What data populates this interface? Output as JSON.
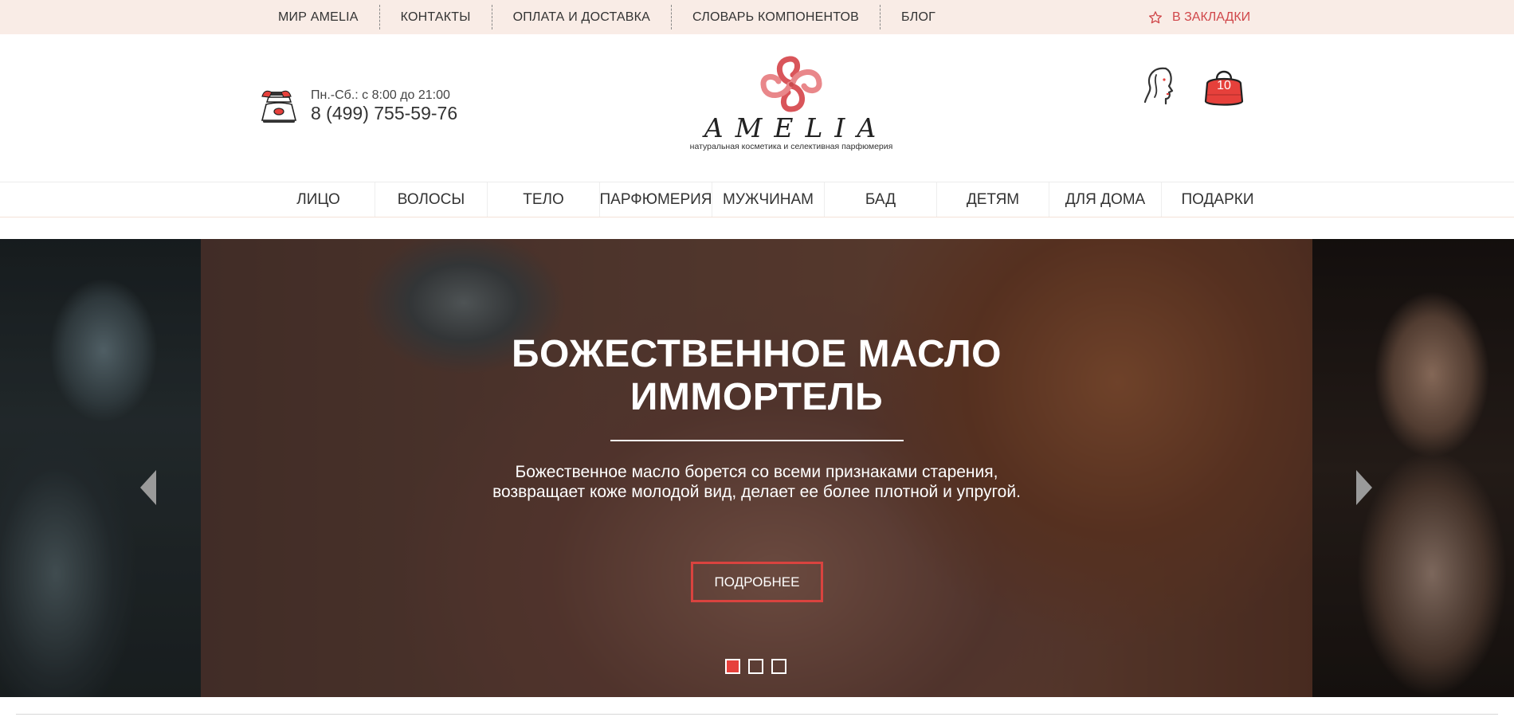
{
  "topbar": {
    "links": [
      "МИР AMELIA",
      "КОНТАКТЫ",
      "ОПЛАТА И ДОСТАВКА",
      "СЛОВАРЬ КОМПОНЕНТОВ",
      "БЛОГ"
    ],
    "bookmarks_label": "В ЗАКЛАДКИ"
  },
  "header": {
    "hours": "Пн.-Сб.: с 8:00 до 21:00",
    "phone": "8 (499) 755-59-76",
    "logo_name": "AMELIA",
    "logo_tagline": "натуральная косметика и селективная парфюмерия",
    "cart_count": "10"
  },
  "mainnav": {
    "items": [
      "ЛИЦО",
      "ВОЛОСЫ",
      "ТЕЛО",
      "ПАРФЮМЕРИЯ",
      "МУЖЧИНАМ",
      "БАД",
      "ДЕТЯМ",
      "ДЛЯ ДОМА",
      "ПОДАРКИ"
    ]
  },
  "slider": {
    "title_line1": "БОЖЕСТВЕННОЕ МАСЛО",
    "title_line2": "ИММОРТЕЛЬ",
    "text": "Божественное масло борется со всеми признаками старения, возвращает коже молодой вид, делает ее более плотной и упругой.",
    "button_label": "ПОДРОБНЕЕ",
    "active_slide": 1,
    "slide_count": 3
  },
  "colors": {
    "topbar_bg": "#f9ece6",
    "accent": "#d9433f",
    "bookmark_text": "#d0474a"
  }
}
